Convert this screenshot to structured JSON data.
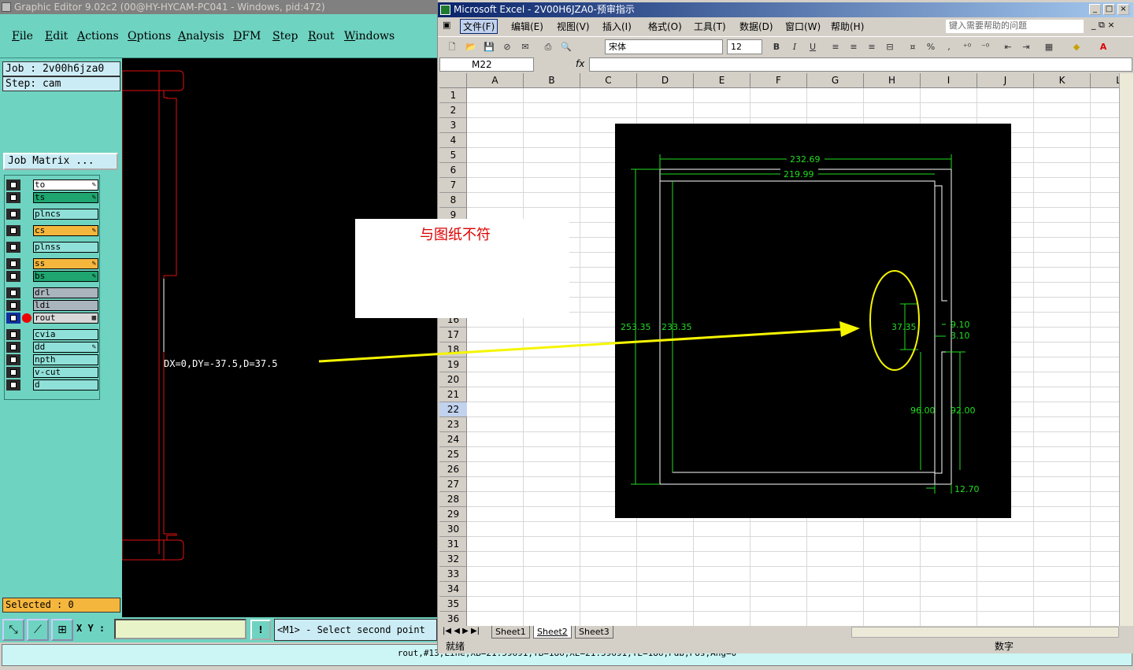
{
  "graphic_editor": {
    "title": "Graphic Editor 9.02c2 (00@HY-HYCAM-PC041 - Windows, pid:472)",
    "menu": [
      "File",
      "Edit",
      "Actions",
      "Options",
      "Analysis",
      "DFM",
      "Step",
      "Rout",
      "Windows"
    ],
    "job_label": "Job : 2v00h6jza0",
    "step_label": "Step: cam",
    "job_matrix_button": "Job Matrix ...",
    "layers": [
      {
        "name": "to",
        "color": "#ffffff",
        "flag": "✎"
      },
      {
        "name": "ts",
        "color": "#1fa56f",
        "flag": "✎"
      },
      {
        "name": "plncs",
        "color": "#8fe0d8",
        "flag": ""
      },
      {
        "name": "cs",
        "color": "#f5b63d",
        "flag": "✎"
      },
      {
        "name": "plnss",
        "color": "#8fe0d8",
        "flag": ""
      },
      {
        "name": "ss",
        "color": "#f5b63d",
        "flag": "✎"
      },
      {
        "name": "bs",
        "color": "#1fa56f",
        "flag": "✎"
      },
      {
        "name": "drl",
        "color": "#a9b4bd",
        "flag": ""
      },
      {
        "name": "ldi",
        "color": "#a9b4bd",
        "flag": ""
      },
      {
        "name": "rout",
        "color": "#d8d8d8",
        "flag": "▦",
        "active": true
      },
      {
        "name": "cvia",
        "color": "#8fe0d8",
        "flag": ""
      },
      {
        "name": "dd",
        "color": "#8fe0d8",
        "flag": "✎"
      },
      {
        "name": "npth",
        "color": "#8fe0d8",
        "flag": ""
      },
      {
        "name": "v-cut",
        "color": "#8fe0d8",
        "flag": ""
      },
      {
        "name": "d",
        "color": "#8fe0d8",
        "flag": ""
      }
    ],
    "selected_label": "Selected : 0",
    "measure_text": "DX=0,DY=-37.5,D=37.5",
    "xy_label": "X Y :",
    "xy_value": "",
    "exclaim": "!",
    "prompt": "<M1> - Select second point",
    "status_line": "rout,#13,Line,XB=21.59691,YB=186,XE=21.59691,YE=186,Pdb,Pos,Ang=0"
  },
  "annotation": {
    "note": "与图纸不符"
  },
  "excel": {
    "title": "Microsoft Excel - 2V00H6JZA0-预审指示",
    "menu": [
      "文件(F)",
      "编辑(E)",
      "视图(V)",
      "插入(I)",
      "格式(O)",
      "工具(T)",
      "数据(D)",
      "窗口(W)",
      "帮助(H)"
    ],
    "help_placeholder": "键入需要帮助的问题",
    "font_name": "宋体",
    "font_size": "12",
    "name_box": "M22",
    "fx": "fx",
    "columns": [
      "A",
      "B",
      "C",
      "D",
      "E",
      "F",
      "G",
      "H",
      "I",
      "J",
      "K",
      "L"
    ],
    "rows": [
      "1",
      "2",
      "3",
      "4",
      "5",
      "6",
      "7",
      "8",
      "9",
      "10",
      "11",
      "12",
      "13",
      "14",
      "15",
      "16",
      "17",
      "18",
      "19",
      "20",
      "21",
      "22",
      "23",
      "24",
      "25",
      "26",
      "27",
      "28",
      "29",
      "30",
      "31",
      "32",
      "33",
      "34",
      "35",
      "36"
    ],
    "selected_row": "22",
    "sheets": [
      "Sheet1",
      "Sheet2",
      "Sheet3"
    ],
    "active_sheet": "Sheet2",
    "status_left": "就绪",
    "status_right": "数字"
  },
  "drawing_dims": {
    "overall_width": "232.69",
    "inner_width": "219.99",
    "overall_height": "253.35",
    "inner_height": "233.35",
    "slot_height": "37.35",
    "offset_a": "9.10",
    "offset_b": "3.10",
    "lower_a": "96.00",
    "lower_b": "92.00",
    "bottom_offset": "12.70"
  }
}
